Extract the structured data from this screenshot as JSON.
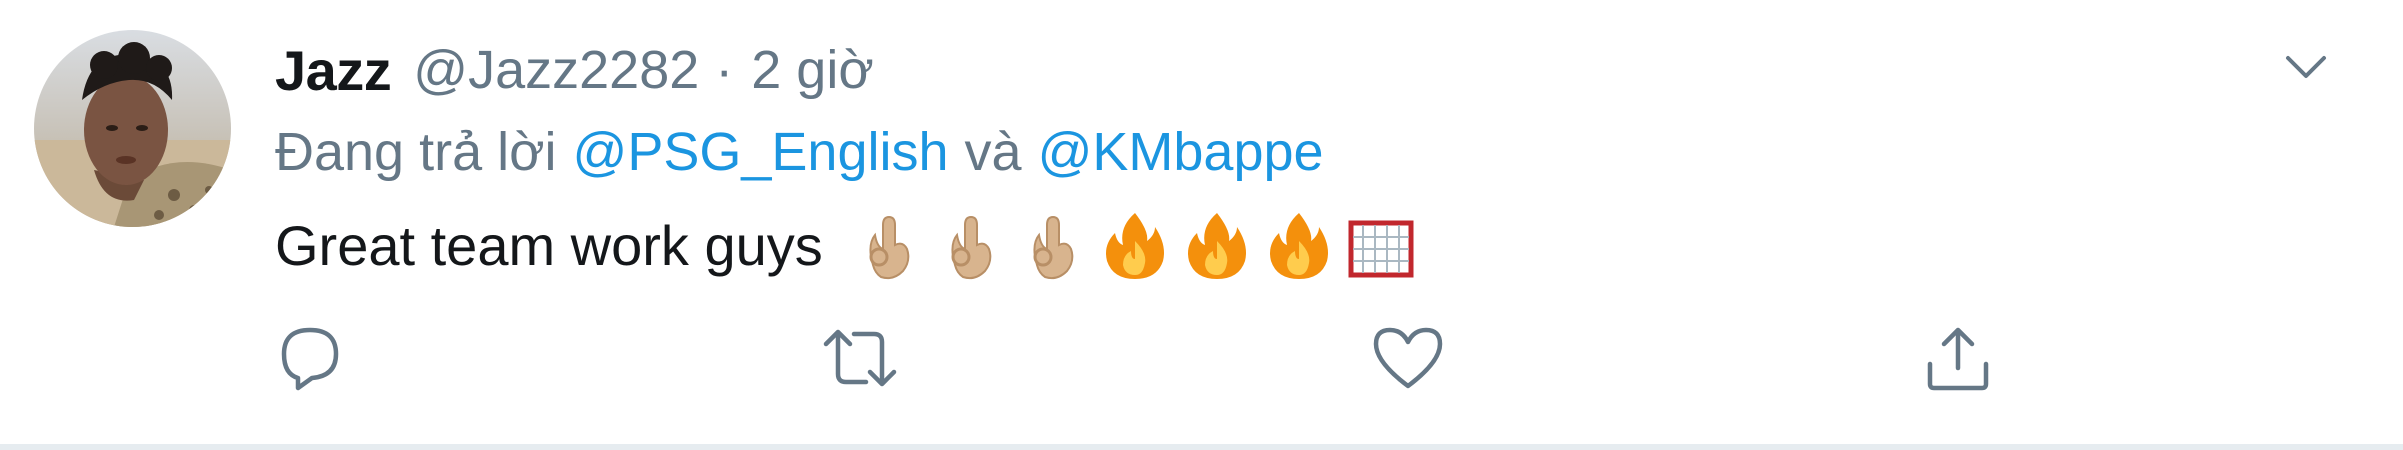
{
  "tweet": {
    "display_name": "Jazz",
    "handle": "@Jazz2282",
    "separator": "·",
    "time": "2 giờ",
    "reply": {
      "prefix": "Đang trả lời",
      "mention_1": "@PSG_English",
      "conjunction": "và",
      "mention_2": "@KMbappe"
    },
    "text": "Great team work guys",
    "emojis": [
      "ok-hand-icon",
      "ok-hand-icon",
      "ok-hand-icon",
      "fire-icon",
      "fire-icon",
      "fire-icon",
      "goal-net-icon"
    ]
  },
  "actions": [
    "reply-icon",
    "retweet-icon",
    "like-icon",
    "share-icon"
  ],
  "colors": {
    "link": "#1b95e0",
    "muted": "#657786",
    "text": "#14171a",
    "divider": "#e6ecf0"
  }
}
